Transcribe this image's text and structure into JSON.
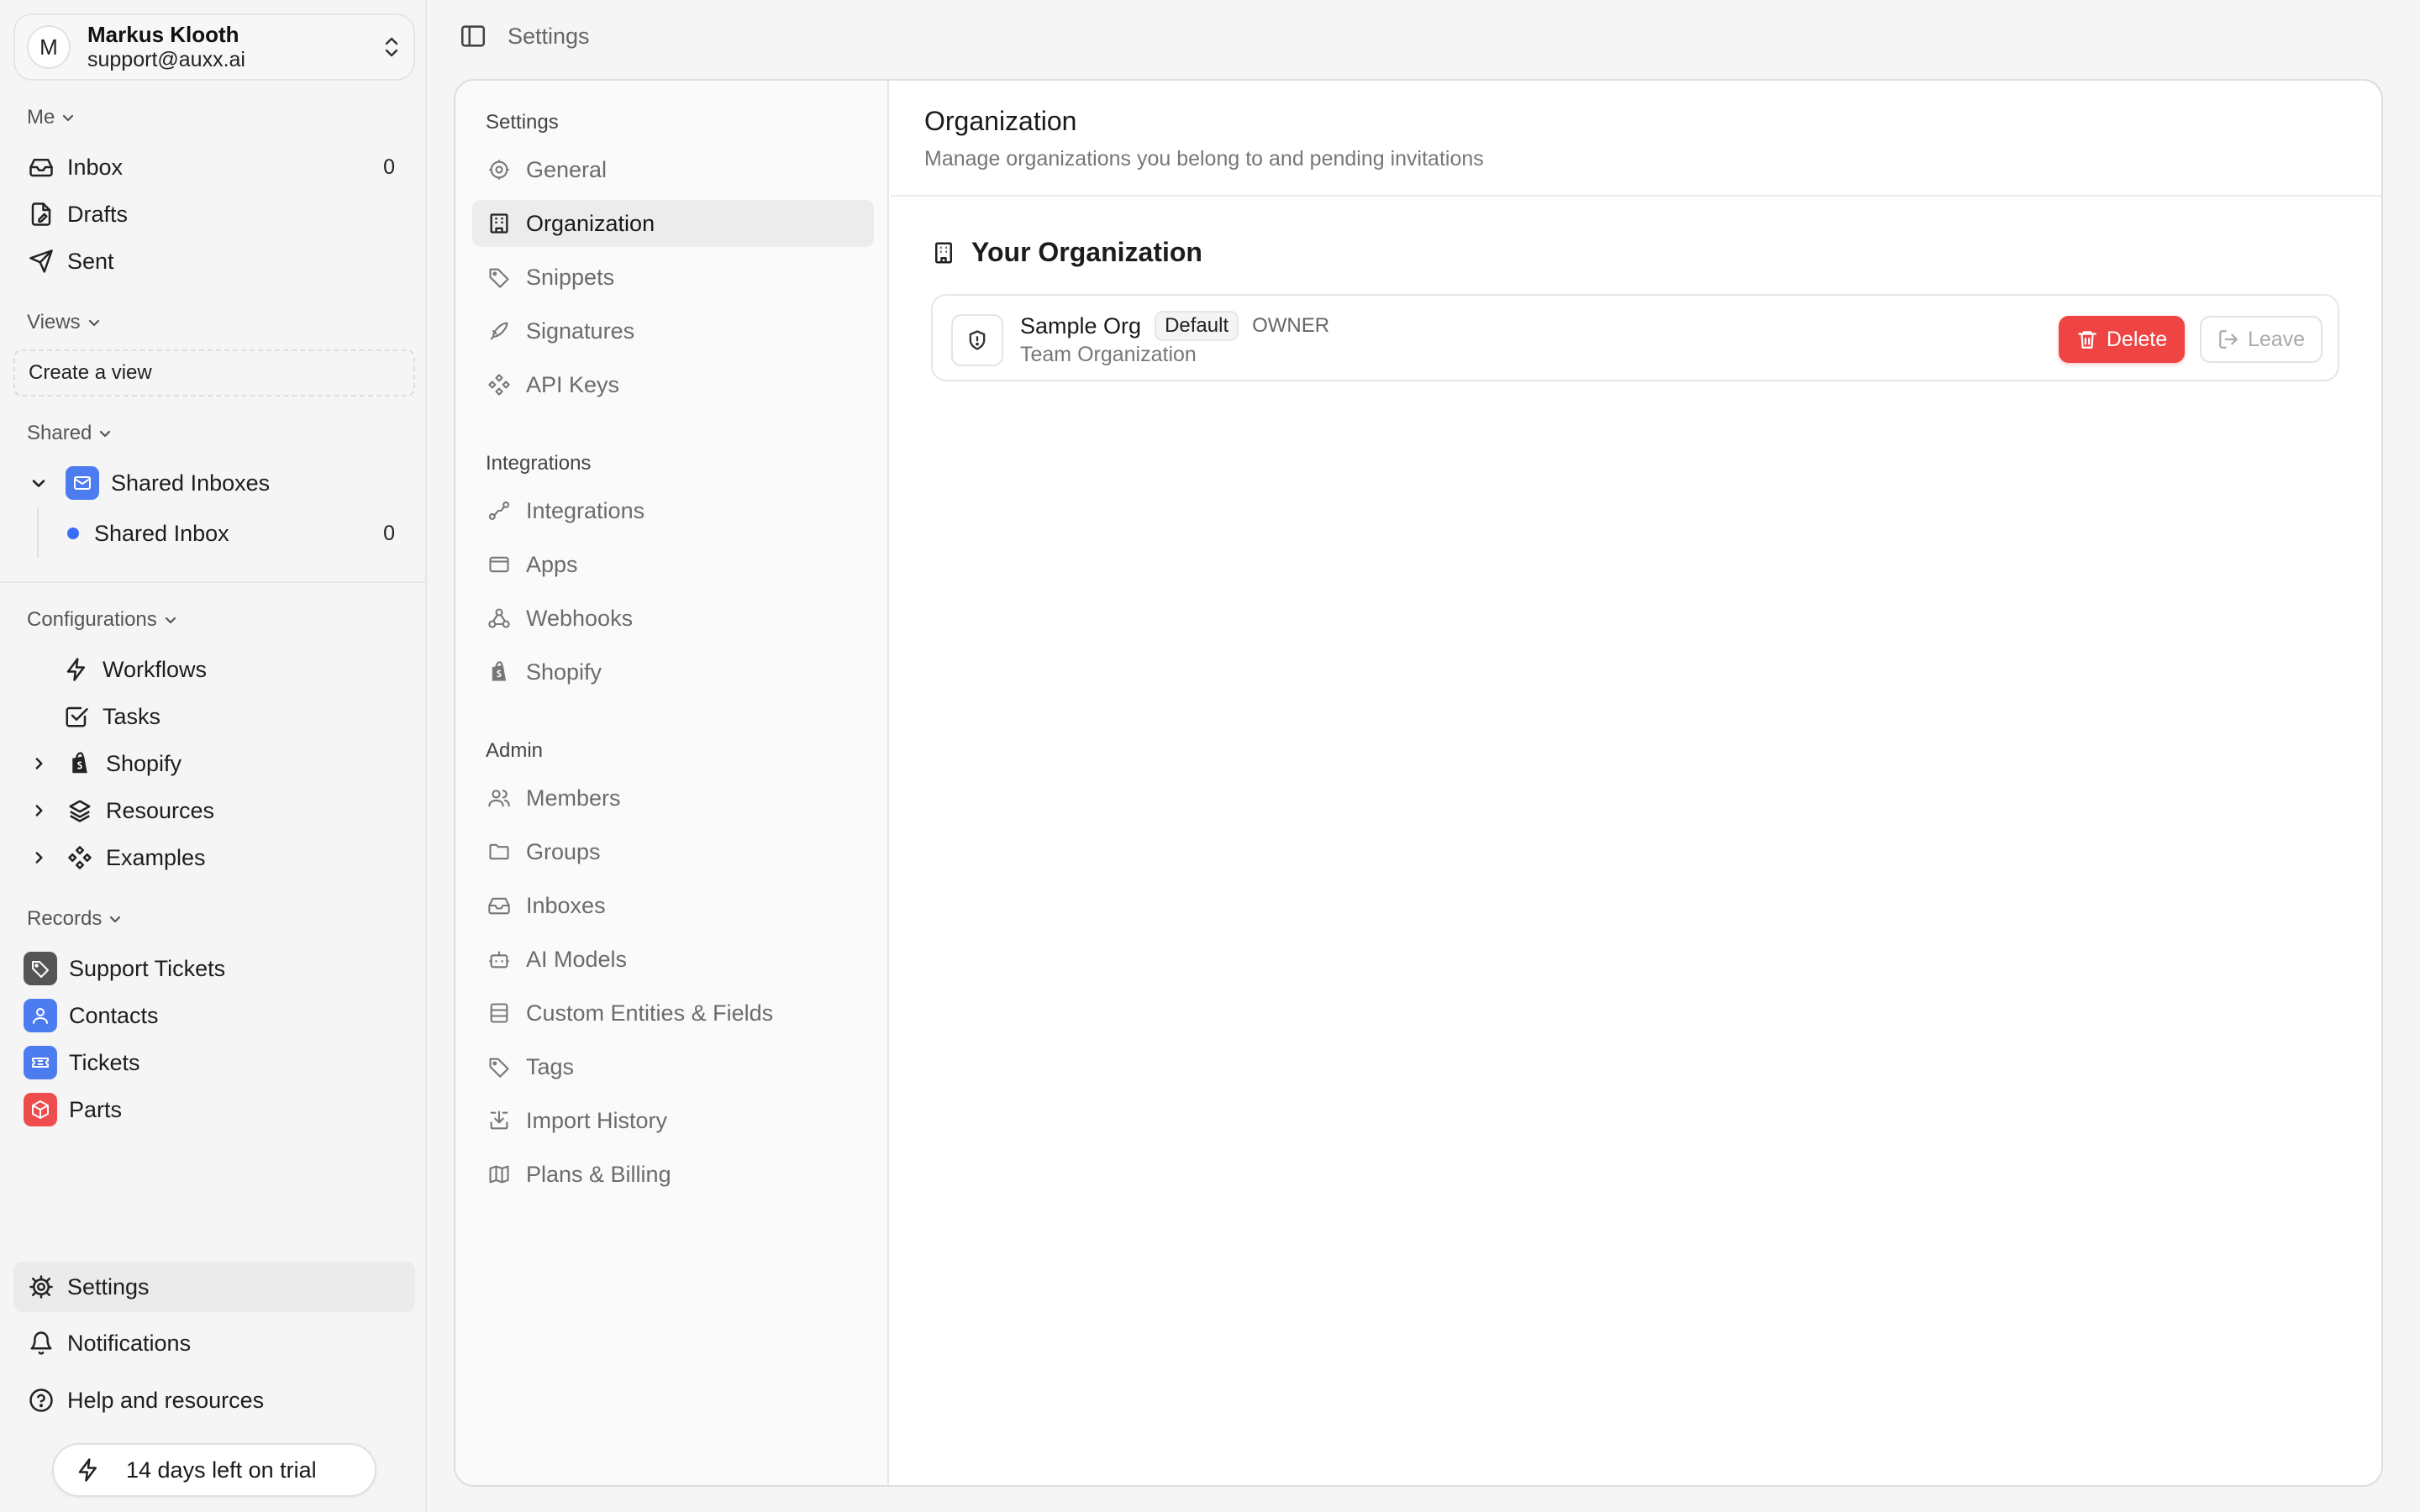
{
  "user": {
    "initial": "M",
    "name": "Markus Klooth",
    "email": "support@auxx.ai"
  },
  "sections": {
    "me": "Me",
    "views": "Views",
    "shared": "Shared",
    "configurations": "Configurations",
    "records": "Records"
  },
  "me_items": [
    {
      "label": "Inbox",
      "count": "0",
      "icon": "inbox-icon"
    },
    {
      "label": "Drafts",
      "icon": "drafts-icon"
    },
    {
      "label": "Sent",
      "icon": "send-icon"
    }
  ],
  "views": {
    "create_label": "Create a view"
  },
  "shared": {
    "group_label": "Shared Inboxes",
    "inbox_label": "Shared Inbox",
    "inbox_count": "0"
  },
  "config_items": [
    "Workflows",
    "Tasks",
    "Shopify",
    "Resources",
    "Examples"
  ],
  "record_items": [
    {
      "label": "Support Tickets",
      "color": "#555555"
    },
    {
      "label": "Contacts",
      "color": "#4c7cf0"
    },
    {
      "label": "Tickets",
      "color": "#4c7cf0"
    },
    {
      "label": "Parts",
      "color": "#ef4d4d"
    }
  ],
  "bottom_nav": {
    "settings": "Settings",
    "notifications": "Notifications",
    "help": "Help and resources"
  },
  "trial": "14 days left on trial",
  "topbar": {
    "title": "Settings"
  },
  "settings_nav": {
    "group1": "Settings",
    "group1_items": [
      "General",
      "Organization",
      "Snippets",
      "Signatures",
      "API Keys"
    ],
    "group2": "Integrations",
    "group2_items": [
      "Integrations",
      "Apps",
      "Webhooks",
      "Shopify"
    ],
    "group3": "Admin",
    "group3_items": [
      "Members",
      "Groups",
      "Inboxes",
      "AI Models",
      "Custom Entities & Fields",
      "Tags",
      "Import History",
      "Plans & Billing"
    ],
    "active": "Organization"
  },
  "content": {
    "title": "Organization",
    "subtitle": "Manage organizations you belong to and pending invitations",
    "section_title": "Your Organization"
  },
  "org": {
    "name": "Sample Org",
    "badge": "Default",
    "role": "OWNER",
    "type": "Team Organization",
    "delete_label": "Delete",
    "leave_label": "Leave"
  },
  "colors": {
    "accent_blue": "#4c7cf0",
    "danger": "#ef4444",
    "dot": "#3b6ef5"
  }
}
